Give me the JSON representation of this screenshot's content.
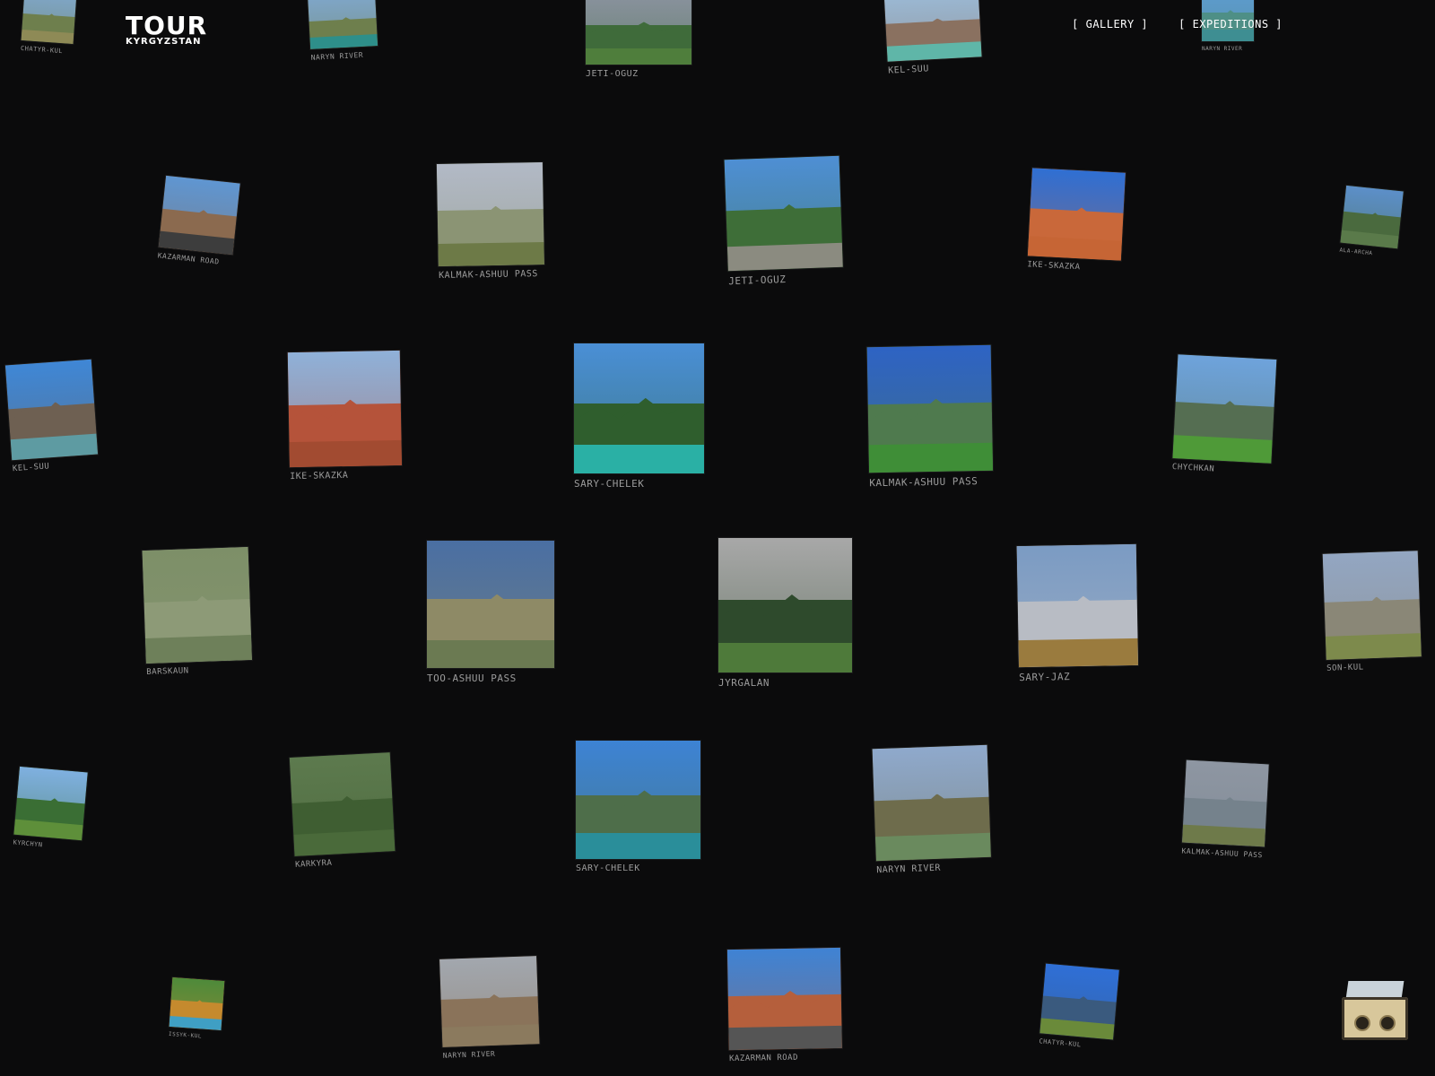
{
  "logo": {
    "main": "TOUR",
    "sub": "KYRGYZSTAN"
  },
  "nav": {
    "gallery": "[ GALLERY ]",
    "expeditions": "[ EXPEDITIONS ]"
  },
  "colors": {
    "background": "#0b0b0c",
    "caption": "#9b9b9b",
    "nav_text": "#ffffff"
  },
  "cards": [
    {
      "label": "CHATYR-KUL",
      "sky": "#7fa6c9",
      "land": "#6e7f4d",
      "ground": "#8e8a56"
    },
    {
      "label": "NARYN RIVER",
      "sky": "#7fa6c9",
      "land": "#6e7f4d",
      "ground": "#2e8f8a"
    },
    {
      "label": "JETI-OGUZ",
      "sky": "#8b93a0",
      "land": "#3f6b3a",
      "ground": "#4f7e3c"
    },
    {
      "label": "KEL-SUU",
      "sky": "#9bbbd8",
      "land": "#8a7160",
      "ground": "#5fb6a8"
    },
    {
      "label": "NARYN RIVER",
      "sky": "#5e9bd1",
      "land": "#4e8f86",
      "ground": "#3e8e92"
    },
    {
      "label": "KAZARMAN ROAD",
      "sky": "#5f96d2",
      "land": "#8b6a4f",
      "ground": "#3d3d3d"
    },
    {
      "label": "KALMAK-ASHUU PASS",
      "sky": "#b2b9c6",
      "land": "#8b9474",
      "ground": "#6d7a47"
    },
    {
      "label": "JETI-OGUZ",
      "sky": "#4e8fd4",
      "land": "#3e6e38",
      "ground": "#8b8b80"
    },
    {
      "label": "IKE-SKAZKA",
      "sky": "#2f6fd3",
      "land": "#c9683a",
      "ground": "#c66535"
    },
    {
      "label": "ALA-ARCHA",
      "sky": "#5c8fc9",
      "land": "#4a6a3e",
      "ground": "#5a7a4a"
    },
    {
      "label": "KEL-SUU",
      "sky": "#3f87d6",
      "land": "#6e6052",
      "ground": "#5e9ba2"
    },
    {
      "label": "IKE-SKAZKA",
      "sky": "#8fb1d9",
      "land": "#b5533a",
      "ground": "#a24b31"
    },
    {
      "label": "SARY-CHELEK",
      "sky": "#4a8fd6",
      "land": "#2f5e2d",
      "ground": "#2ab0a5"
    },
    {
      "label": "KALMAK-ASHUU PASS",
      "sky": "#2e63c4",
      "land": "#4f7a4e",
      "ground": "#3f8e37"
    },
    {
      "label": "CHYCHKAN",
      "sky": "#6ea3dc",
      "land": "#556e52",
      "ground": "#4f9a38"
    },
    {
      "label": "BARSKAUN",
      "sky": "#7d8f68",
      "land": "#8d9a77",
      "ground": "#6e805a"
    },
    {
      "label": "TOO-ASHUU PASS",
      "sky": "#4a6fa3",
      "land": "#8e8a66",
      "ground": "#6b7a52"
    },
    {
      "label": "JYRGALAN",
      "sky": "#a8a8a8",
      "land": "#2e4a2c",
      "ground": "#4e7a3a"
    },
    {
      "label": "SARY-JAZ",
      "sky": "#7b9bc3",
      "land": "#b8bcc4",
      "ground": "#9a7b3e"
    },
    {
      "label": "SON-KUL",
      "sky": "#93a6c2",
      "land": "#8a8777",
      "ground": "#7d8a4c"
    },
    {
      "label": "KYRCHYN",
      "sky": "#7fb0e0",
      "land": "#3a6e34",
      "ground": "#5e8f3a"
    },
    {
      "label": "KARKYRA",
      "sky": "#5d7a4e",
      "land": "#3f5e32",
      "ground": "#4a6a3a"
    },
    {
      "label": "SARY-CHELEK",
      "sky": "#3d83d4",
      "land": "#4e6e4a",
      "ground": "#2a8e9a"
    },
    {
      "label": "NARYN RIVER",
      "sky": "#8fa9cc",
      "land": "#6e6c4c",
      "ground": "#6a8a5e"
    },
    {
      "label": "KALMAK-ASHUU PASS",
      "sky": "#8e96a2",
      "land": "#75828c",
      "ground": "#6e7a4a"
    },
    {
      "label": "ISSYK-KUL",
      "sky": "#4e8a3a",
      "land": "#c58a2e",
      "ground": "#3f9fc4"
    },
    {
      "label": "NARYN RIVER",
      "sky": "#a2a7ae",
      "land": "#8a735a",
      "ground": "#8b7a5e"
    },
    {
      "label": "KAZARMAN ROAD",
      "sky": "#3f83d4",
      "land": "#b55f3c",
      "ground": "#555555"
    },
    {
      "label": "CHATYR-KUL",
      "sky": "#2f6fd6",
      "land": "#3a5a7e",
      "ground": "#6a8a3a"
    }
  ]
}
